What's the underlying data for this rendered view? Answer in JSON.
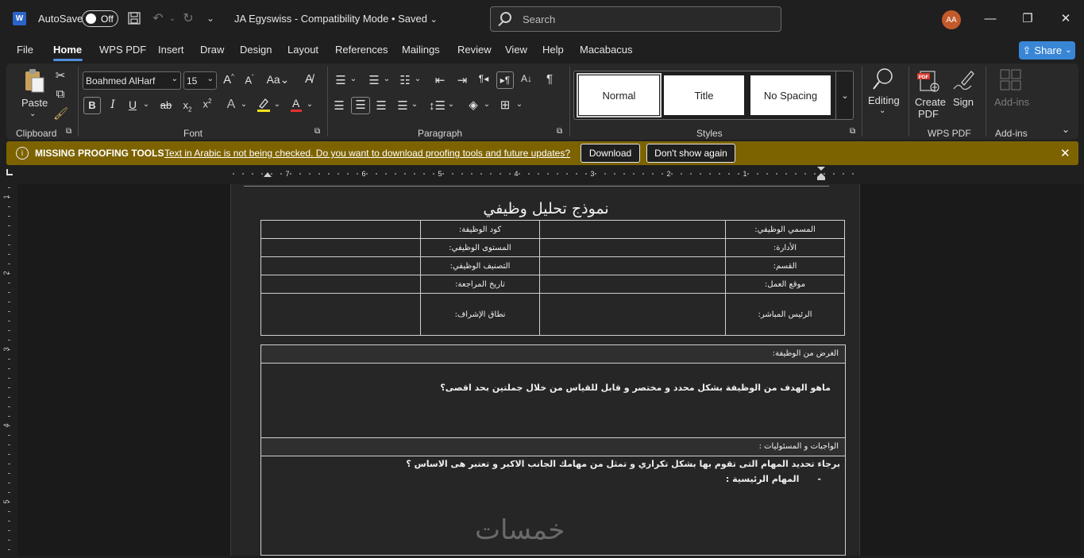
{
  "titlebar": {
    "autosave_label": "AutoSave",
    "autosave_state": "Off",
    "doc_title": "JA Egyswiss  -  Compatibility Mode • Saved",
    "search_placeholder": "Search",
    "user_initials": "AA"
  },
  "tabs": [
    "File",
    "Home",
    "WPS PDF",
    "Insert",
    "Draw",
    "Design",
    "Layout",
    "References",
    "Mailings",
    "Review",
    "View",
    "Help",
    "Macabacus"
  ],
  "share_label": "Share",
  "ribbon": {
    "clipboard": {
      "paste_label": "Paste",
      "group_label": "Clipboard"
    },
    "font": {
      "font_name": "Boahmed AlHarf",
      "font_size": "15",
      "group_label": "Font"
    },
    "paragraph": {
      "group_label": "Paragraph"
    },
    "styles": {
      "items": [
        "Normal",
        "Title",
        "No Spacing"
      ],
      "group_label": "Styles"
    },
    "editing": {
      "label": "Editing"
    },
    "wps_pdf": {
      "create_pdf": "Create PDF",
      "sign": "Sign",
      "group_label": "WPS PDF"
    },
    "addins": {
      "label": "Add-ins",
      "group_label": "Add-ins"
    }
  },
  "warning": {
    "title": "MISSING PROOFING TOOLS",
    "message": "Text in Arabic is not being checked. Do you want to download proofing tools and future updates?",
    "download_label": "Download",
    "dont_show_label": "Don't show again"
  },
  "ruler": {
    "numbers": [
      "7",
      "6",
      "5",
      "4",
      "3",
      "2",
      "1"
    ],
    "vertical_numbers": [
      "1",
      "2",
      "3",
      "4",
      "5"
    ]
  },
  "document": {
    "heading": "نموذج تحليل وظيفي",
    "info_table": [
      [
        "المسمي الوظيفي:",
        "",
        "كود الوظيفة:",
        ""
      ],
      [
        "الأدارة:",
        "",
        "المستوى الوظيفي:",
        ""
      ],
      [
        "القسم:",
        "",
        "التصنيف الوظيفي:",
        ""
      ],
      [
        "موقع العمل:",
        "",
        "تاريخ المراجعة:",
        ""
      ],
      [
        "الرئيس المباشر:",
        "",
        "نطاق الإشراف:",
        ""
      ]
    ],
    "purpose_header": "الغرض من الوظيفة:",
    "purpose_question": "ماهو الهدف من الوظيفة بشكل محدد و مختصر و قابل للقياس  من خلال جملتين بحد اقصى؟",
    "duties_header": "الواجبات و المسئوليات :",
    "duties_question": "برجاء تحديد المهام التى تقوم بها بشكل تكراري و تمثل من مهامك الجانب الاكبر و تعتبر هى الاساس ؟",
    "main_tasks": "المهام الرئيسية :",
    "main_tasks_bullet": "-"
  },
  "watermark": "خمسات"
}
